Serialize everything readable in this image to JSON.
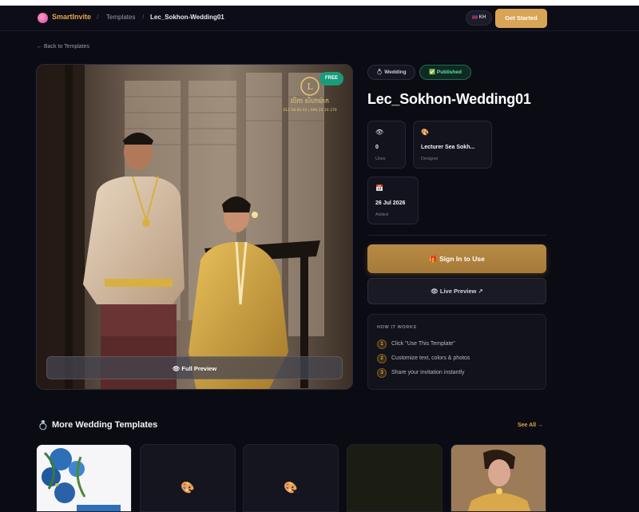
{
  "nav": {
    "brand": "SmartInvite",
    "sep1": "/",
    "crumb_templates": "Templates",
    "sep2": "/",
    "crumb_current": "Lec_Sokhon-Wedding01",
    "lang": "KH",
    "cta": "Get Started"
  },
  "back_link": "← Back to Templates",
  "preview": {
    "badge": "FREE",
    "full_preview": "👁 Full Preview",
    "logo_monogram": "L",
    "logo_text": "លិកា សីហាម៉ាក",
    "logo_phone": "012 58 80 02 | 096 20 10 270"
  },
  "template": {
    "category_tag": "💍 Wedding",
    "status_tag": "✅ Published",
    "title": "Lec_Sokhon-Wedding01"
  },
  "stats": [
    {
      "icon": "👁",
      "value": "0",
      "label": "Uses"
    },
    {
      "icon": "🎨",
      "value": "Lecturer Sea Sokh...",
      "label": "Designer"
    },
    {
      "icon": "📅",
      "value": "26 Jul 2026",
      "label": "Added"
    }
  ],
  "actions": {
    "sign_in": "🎁 Sign In to Use",
    "live_preview": "👁 Live Preview ↗"
  },
  "how_it_works": {
    "title": "HOW IT WORKS",
    "steps": [
      {
        "num": "1",
        "text": "Click \"Use This Template\""
      },
      {
        "num": "2",
        "text": "Customize text, colors & photos"
      },
      {
        "num": "3",
        "text": "Share your invitation instantly"
      }
    ]
  },
  "more": {
    "icon": "💍",
    "title": "More Wedding Templates",
    "see_all": "See All →",
    "placeholder_icon": "🎨"
  },
  "colors": {
    "background": "#0b0b14",
    "accent_gold": "#d8a455",
    "published_green": "#5fe0a8",
    "free_badge": "#1a9c7a"
  }
}
